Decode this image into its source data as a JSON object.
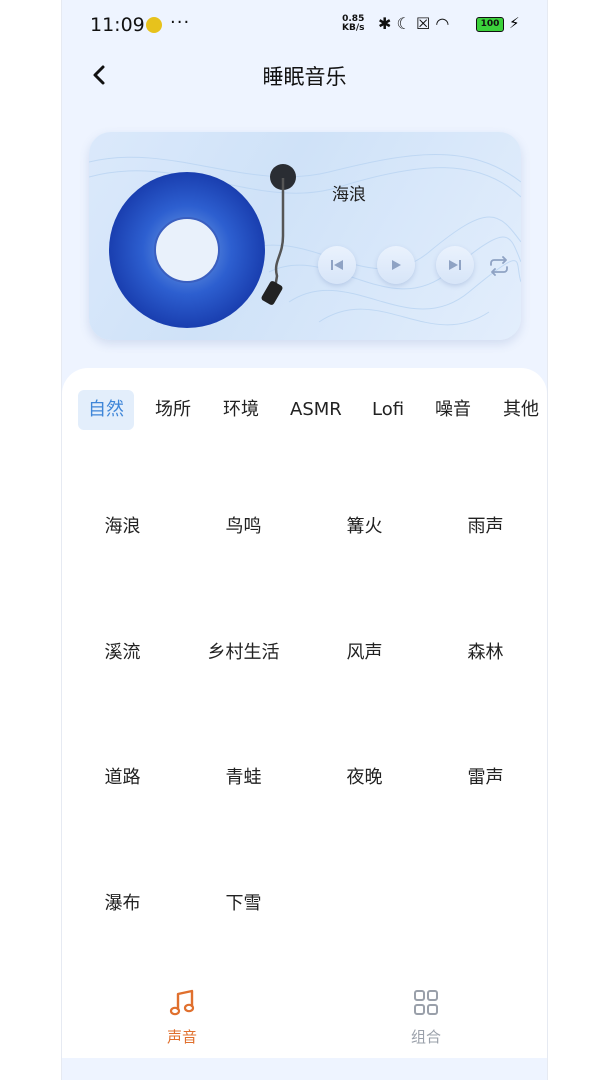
{
  "status_bar": {
    "time": "11:09",
    "more": "···",
    "speed_value": "0.85",
    "speed_unit": "KB/s",
    "battery": "100"
  },
  "header": {
    "back_icon": "chevron-left-icon",
    "title": "睡眠音乐"
  },
  "player": {
    "track_name": "海浪",
    "controls": [
      "previous-icon",
      "play-icon",
      "next-icon",
      "repeat-icon"
    ]
  },
  "tabs": [
    {
      "label": "自然",
      "active": true
    },
    {
      "label": "场所",
      "active": false
    },
    {
      "label": "环境",
      "active": false
    },
    {
      "label": "ASMR",
      "active": false
    },
    {
      "label": "Lofi",
      "active": false
    },
    {
      "label": "噪音",
      "active": false
    },
    {
      "label": "其他",
      "active": false
    }
  ],
  "sounds": [
    "海浪",
    "鸟鸣",
    "篝火",
    "雨声",
    "溪流",
    "乡村生活",
    "风声",
    "森林",
    "道路",
    "青蛙",
    "夜晚",
    "雷声",
    "瀑布",
    "下雪"
  ],
  "bottom_nav": [
    {
      "label": "声音",
      "icon": "music-note-icon",
      "active": true,
      "color": "#e0702e"
    },
    {
      "label": "组合",
      "icon": "grid-icon",
      "active": false,
      "color": "#9aa0aa"
    }
  ],
  "colors": {
    "accent": "#3f86d8",
    "nav_active": "#e0702e",
    "background": "#eef4ff"
  }
}
